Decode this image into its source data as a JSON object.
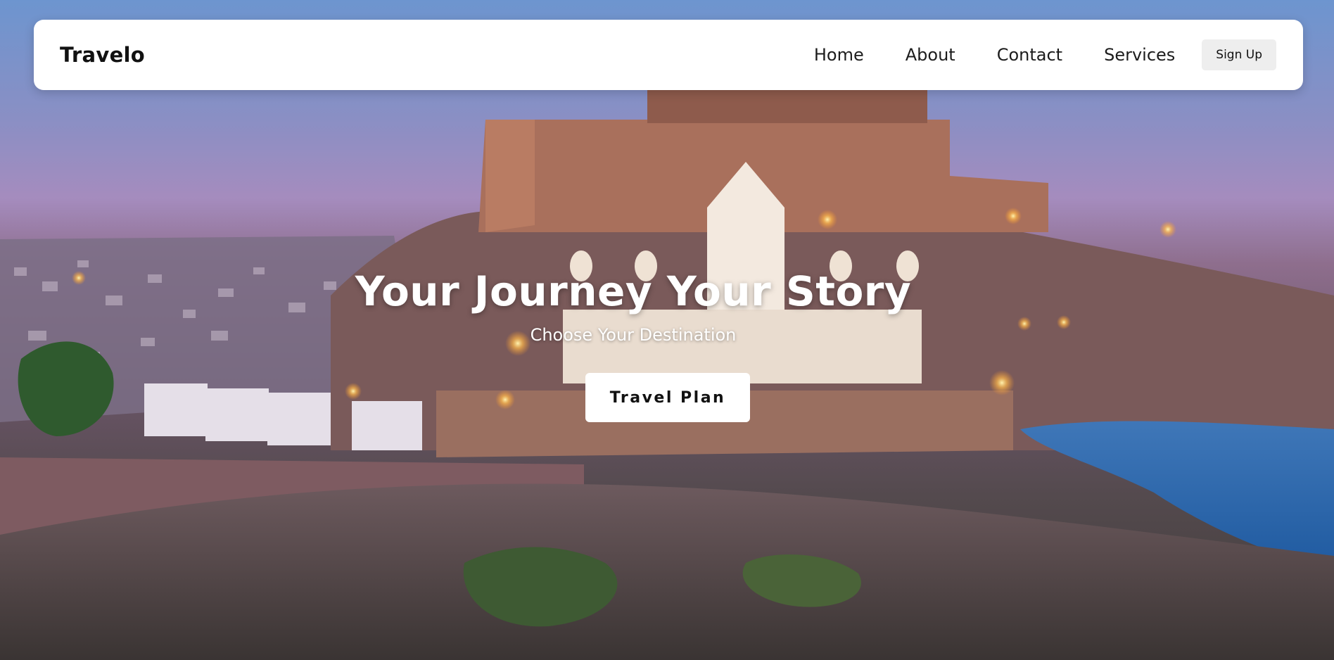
{
  "nav": {
    "brand": "Travelo",
    "links": [
      "Home",
      "About",
      "Contact",
      "Services"
    ],
    "signup_label": "Sign Up"
  },
  "hero": {
    "title": "Your Journey Your Story",
    "subtitle": "Choose Your Destination",
    "cta_label": "Travel Plan",
    "background_image": "night-view-of-hilltop-fort-and-marble-memorial-with-lake"
  },
  "colors": {
    "nav_bg": "#ffffff",
    "text_dark": "#111111",
    "signup_bg": "#eeeeee",
    "hero_text": "#ffffff"
  }
}
